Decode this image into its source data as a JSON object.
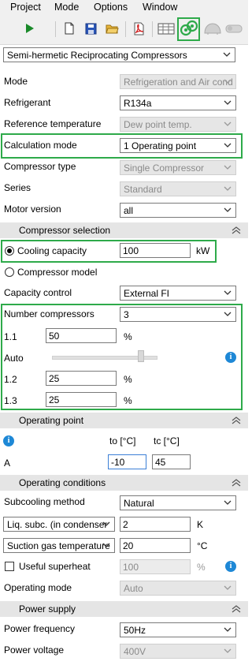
{
  "menu": [
    "Project",
    "Mode",
    "Options",
    "Window"
  ],
  "product_line": "Semi-hermetic Reciprocating Compressors",
  "fields": {
    "mode": {
      "label": "Mode",
      "value": "Refrigeration and Air cond"
    },
    "refrigerant": {
      "label": "Refrigerant",
      "value": "R134a"
    },
    "reference_temperature": {
      "label": "Reference temperature",
      "value": "Dew point temp."
    },
    "calculation_mode": {
      "label": "Calculation mode",
      "value": "1 Operating point"
    },
    "compressor_type": {
      "label": "Compressor type",
      "value": "Single Compressor"
    },
    "series": {
      "label": "Series",
      "value": "Standard"
    },
    "motor_version": {
      "label": "Motor version",
      "value": "all"
    }
  },
  "sections": {
    "compressor_selection": "Compressor selection",
    "operating_point": "Operating point",
    "operating_conditions": "Operating conditions",
    "power_supply": "Power supply"
  },
  "compressor_selection": {
    "cooling_capacity_label": "Cooling capacity",
    "cooling_capacity_value": "100",
    "cooling_capacity_unit": "kW",
    "compressor_model_label": "Compressor model",
    "capacity_control_label": "Capacity control",
    "capacity_control_value": "External FI",
    "number_compressors_label": "Number compressors",
    "number_compressors_value": "3",
    "rows": [
      {
        "label": "1.1",
        "value": "50",
        "unit": "%"
      },
      {
        "label": "1.2",
        "value": "25",
        "unit": "%"
      },
      {
        "label": "1.3",
        "value": "25",
        "unit": "%"
      }
    ],
    "auto_label": "Auto"
  },
  "operating_point": {
    "to_header": "to [°C]",
    "tc_header": "tc [°C]",
    "row_label": "A",
    "to_value": "-10",
    "tc_value": "45"
  },
  "operating_conditions": {
    "subcooling_method_label": "Subcooling method",
    "subcooling_method_value": "Natural",
    "liq_subc_select": "Liq. subc. (in condenser",
    "liq_subc_value": "2",
    "liq_subc_unit": "K",
    "suction_gas_select": "Suction gas temperature",
    "suction_gas_value": "20",
    "suction_gas_unit": "°C",
    "useful_superheat_label": "Useful superheat",
    "useful_superheat_value": "100",
    "useful_superheat_unit": "%",
    "operating_mode_label": "Operating mode",
    "operating_mode_value": "Auto"
  },
  "power_supply": {
    "frequency_label": "Power frequency",
    "frequency_value": "50Hz",
    "voltage_label": "Power voltage",
    "voltage_value": "400V"
  },
  "colors": {
    "highlight": "#2eaa4a",
    "info": "#1e88d6",
    "section_bg": "#e5e5e5"
  }
}
